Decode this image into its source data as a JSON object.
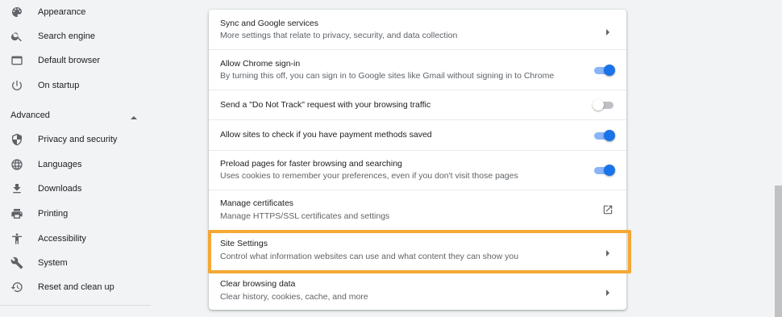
{
  "sidebar": {
    "items_top": [
      {
        "label": "Appearance",
        "icon": "palette-icon"
      },
      {
        "label": "Search engine",
        "icon": "search-icon"
      },
      {
        "label": "Default browser",
        "icon": "browser-window-icon"
      },
      {
        "label": "On startup",
        "icon": "power-icon"
      }
    ],
    "advanced_label": "Advanced",
    "items_advanced": [
      {
        "label": "Privacy and security",
        "icon": "shield-icon"
      },
      {
        "label": "Languages",
        "icon": "globe-icon"
      },
      {
        "label": "Downloads",
        "icon": "download-icon"
      },
      {
        "label": "Printing",
        "icon": "printer-icon"
      },
      {
        "label": "Accessibility",
        "icon": "accessibility-icon"
      },
      {
        "label": "System",
        "icon": "wrench-icon"
      },
      {
        "label": "Reset and clean up",
        "icon": "reset-icon"
      }
    ]
  },
  "rows": [
    {
      "title": "Sync and Google services",
      "sub": "More settings that relate to privacy, security, and data collection",
      "control": "arrow"
    },
    {
      "title": "Allow Chrome sign-in",
      "sub": "By turning this off, you can sign in to Google sites like Gmail without signing in to Chrome",
      "control": "toggle",
      "state": "on"
    },
    {
      "title": "Send a \"Do Not Track\" request with your browsing traffic",
      "control": "toggle",
      "state": "off"
    },
    {
      "title": "Allow sites to check if you have payment methods saved",
      "control": "toggle",
      "state": "on"
    },
    {
      "title": "Preload pages for faster browsing and searching",
      "sub": "Uses cookies to remember your preferences, even if you don't visit those pages",
      "control": "toggle",
      "state": "on"
    },
    {
      "title": "Manage certificates",
      "sub": "Manage HTTPS/SSL certificates and settings",
      "control": "external"
    },
    {
      "title": "Site Settings",
      "sub": "Control what information websites can use and what content they can show you",
      "control": "arrow"
    },
    {
      "title": "Clear browsing data",
      "sub": "Clear history, cookies, cache, and more",
      "control": "arrow"
    }
  ],
  "colors": {
    "highlight": "#f4a834",
    "toggle_on": "#1a73e8"
  }
}
